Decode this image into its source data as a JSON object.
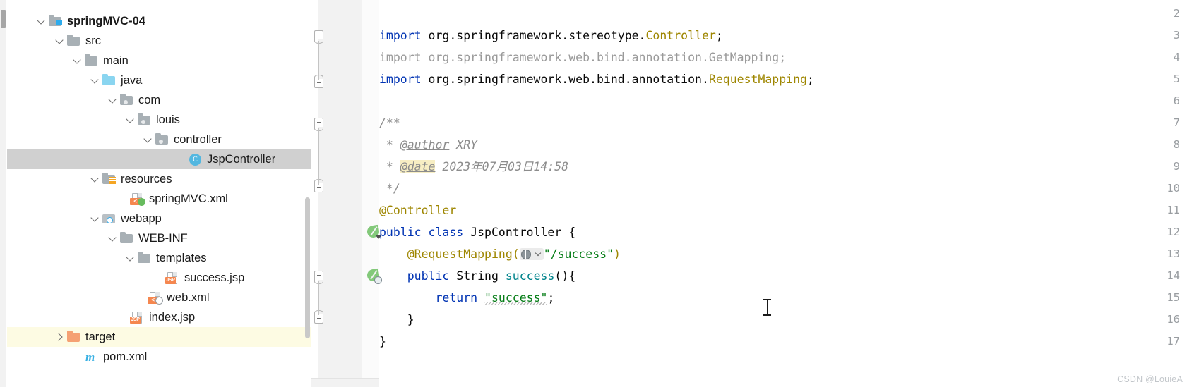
{
  "project_tree": {
    "name": "Project tool window",
    "items": [
      {
        "label": "springMVC-04",
        "icon": "source-root-folder-icon",
        "indent": 0,
        "expanded": true,
        "bold": true,
        "state": "normal"
      },
      {
        "label": "src",
        "icon": "folder-icon",
        "indent": 1,
        "expanded": true,
        "bold": false,
        "state": "normal"
      },
      {
        "label": "main",
        "icon": "folder-icon",
        "indent": 2,
        "expanded": true,
        "bold": false,
        "state": "normal"
      },
      {
        "label": "java",
        "icon": "source-folder-icon",
        "indent": 3,
        "expanded": true,
        "bold": false,
        "state": "normal"
      },
      {
        "label": "com",
        "icon": "package-icon",
        "indent": 4,
        "expanded": true,
        "bold": false,
        "state": "normal"
      },
      {
        "label": "louis",
        "icon": "package-icon",
        "indent": 5,
        "expanded": true,
        "bold": false,
        "state": "normal"
      },
      {
        "label": "controller",
        "icon": "package-icon",
        "indent": 6,
        "expanded": true,
        "bold": false,
        "state": "normal"
      },
      {
        "label": "JspController",
        "icon": "java-class-icon",
        "indent": 7,
        "expanded": null,
        "bold": false,
        "state": "selected"
      },
      {
        "label": "resources",
        "icon": "resources-folder-icon",
        "indent": 3,
        "expanded": true,
        "bold": false,
        "state": "normal"
      },
      {
        "label": "springMVC.xml",
        "icon": "spring-xml-file-icon",
        "indent": 4,
        "expanded": null,
        "bold": false,
        "state": "normal"
      },
      {
        "label": "webapp",
        "icon": "webapp-folder-icon",
        "indent": 3,
        "expanded": true,
        "bold": false,
        "state": "normal"
      },
      {
        "label": "WEB-INF",
        "icon": "folder-icon",
        "indent": 4,
        "expanded": true,
        "bold": false,
        "state": "normal"
      },
      {
        "label": "templates",
        "icon": "folder-icon",
        "indent": 5,
        "expanded": true,
        "bold": false,
        "state": "normal"
      },
      {
        "label": "success.jsp",
        "icon": "jsp-file-icon",
        "indent": 6,
        "expanded": null,
        "bold": false,
        "state": "normal"
      },
      {
        "label": "web.xml",
        "icon": "web-xml-file-icon",
        "indent": 5,
        "expanded": null,
        "bold": false,
        "state": "normal"
      },
      {
        "label": "index.jsp",
        "icon": "jsp-file-icon",
        "indent": 4,
        "expanded": null,
        "bold": false,
        "state": "normal"
      },
      {
        "label": "target",
        "icon": "excluded-folder-icon",
        "indent": 1,
        "expanded": false,
        "bold": false,
        "state": "excluded"
      },
      {
        "label": "pom.xml",
        "icon": "maven-file-icon",
        "indent": 1,
        "expanded": null,
        "bold": false,
        "state": "normal"
      }
    ]
  },
  "editor": {
    "name": "JspController.java editor",
    "first_visible_line": 2,
    "lines": [
      {
        "num": 2,
        "text": ""
      },
      {
        "num": 3,
        "text": "import org.springframework.stereotype.Controller;"
      },
      {
        "num": 4,
        "text": "import org.springframework.web.bind.annotation.GetMapping;"
      },
      {
        "num": 5,
        "text": "import org.springframework.web.bind.annotation.RequestMapping;"
      },
      {
        "num": 6,
        "text": ""
      },
      {
        "num": 7,
        "text": "/**"
      },
      {
        "num": 8,
        "text": " * @author XRY"
      },
      {
        "num": 9,
        "text": " * @date 2023年07月03日14:58"
      },
      {
        "num": 10,
        "text": " */"
      },
      {
        "num": 11,
        "text": "@Controller"
      },
      {
        "num": 12,
        "text": "public class JspController {"
      },
      {
        "num": 13,
        "text": "    @RequestMapping(\"/success\")"
      },
      {
        "num": 14,
        "text": "    public String success(){"
      },
      {
        "num": 15,
        "text": "        return \"success\";"
      },
      {
        "num": 16,
        "text": "    }"
      },
      {
        "num": 17,
        "text": "}"
      }
    ],
    "tokens": {
      "kw_import": "import",
      "kw_public": "public",
      "kw_class": "class",
      "kw_return": "return",
      "pkg_stereotype": "org.springframework.stereotype.",
      "pkg_annotation": "org.springframework.web.bind.annotation.",
      "type_controller": "Controller",
      "type_getmapping": "GetMapping",
      "type_requestmapping": "RequestMapping",
      "import_line4_full": "import org.springframework.web.bind.annotation.GetMapping;",
      "javadoc_open": "/**",
      "javadoc_close": " */",
      "javadoc_star": " * ",
      "tag_author": "@author",
      "author_value": "XRY",
      "tag_date": "@date",
      "date_value": "2023年07月03日14:58",
      "anno_controller": "@Controller",
      "anno_requestmapping": "@RequestMapping(",
      "anno_close": ")",
      "class_name": "JspController",
      "brace_open": " {",
      "brace_close": "}",
      "type_string": "String",
      "method_name": "success",
      "method_sig_tail": "(){",
      "url_string": "\"/success\"",
      "return_string": "\"success\"",
      "semicolon": ";"
    },
    "gutter_icons": [
      {
        "line": 12,
        "icon": "spring-bean-gutter-icon"
      },
      {
        "line": 14,
        "icon": "spring-request-mapping-gutter-icon"
      }
    ]
  },
  "watermark": {
    "text": "CSDN @LouieA"
  },
  "colors": {
    "keyword": "#0033b3",
    "class_name": "#9e8600",
    "annotation": "#9e8600",
    "string": "#067d17",
    "method": "#00848c",
    "comment": "#8c8c8c",
    "unused_import": "#9a9a9a",
    "selection": "#d0d0d0",
    "excluded_row": "#fdfbe3",
    "date_highlight": "#f7eec3",
    "spring_green": "#83c97a"
  }
}
